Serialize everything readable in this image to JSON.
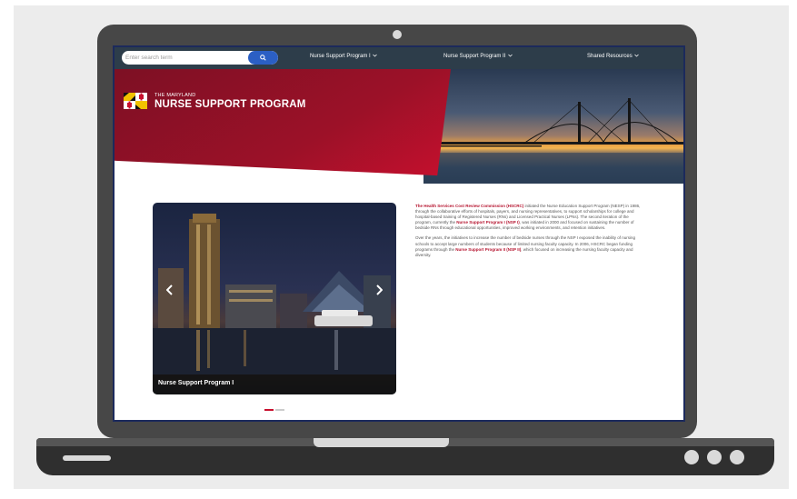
{
  "header": {
    "search_placeholder": "Enter search term",
    "search_icon": "search-icon",
    "nav": [
      {
        "label": "Nurse Support Program I",
        "icon": "chevron-down-icon"
      },
      {
        "label": "Nurse Support Program II",
        "icon": "chevron-down-icon"
      },
      {
        "label": "Shared Resources",
        "icon": "chevron-down-icon"
      }
    ]
  },
  "hero": {
    "subtitle": "THE MARYLAND",
    "title": "NURSE SUPPORT PROGRAM",
    "logo": "maryland-flag-logo"
  },
  "carousel": {
    "caption": "Nurse Support Program I",
    "prev_icon": "chevron-left-icon",
    "next_icon": "chevron-right-icon",
    "slide_count": 2,
    "active_slide": 1
  },
  "article": {
    "p1": {
      "link1": "The Health Services Cost Review Commission (HSCRC)",
      "text1": " initiated the Nurse Education Support Program (NESP) in 1986, through the collaborative efforts of hospitals, payers, and nursing representatives, to support scholarships for college and hospital-based training of Registered Nurses (RNs) and Licensed Practical Nurses (LPNs). The second iteration of the program, currently the ",
      "link2": "Nurse Support Program I (NSP I)",
      "text2": ", was initiated in 2000 and focused on sustaining the number of bedside RNs through educational opportunities, improved working environments, and retention initiatives."
    },
    "p2": {
      "text1": "Over the years, the initiatives to increase the number of bedside nurses through the NSP I exposed the inability of nursing schools to accept large numbers of students because of limited nursing faculty capacity. In 2006, HSCRC began funding programs through the ",
      "link1": "Nurse Support Program II (NSP II)",
      "text2": ", which focused on increasing the nursing faculty capacity and diversity."
    }
  },
  "colors": {
    "brand_red": "#c8102e",
    "dark_red": "#7d1024",
    "nav_bg": "#2d3d4a",
    "search_button": "#2b5fc4",
    "link": "#b5122d",
    "laptop_body": "#474747"
  }
}
